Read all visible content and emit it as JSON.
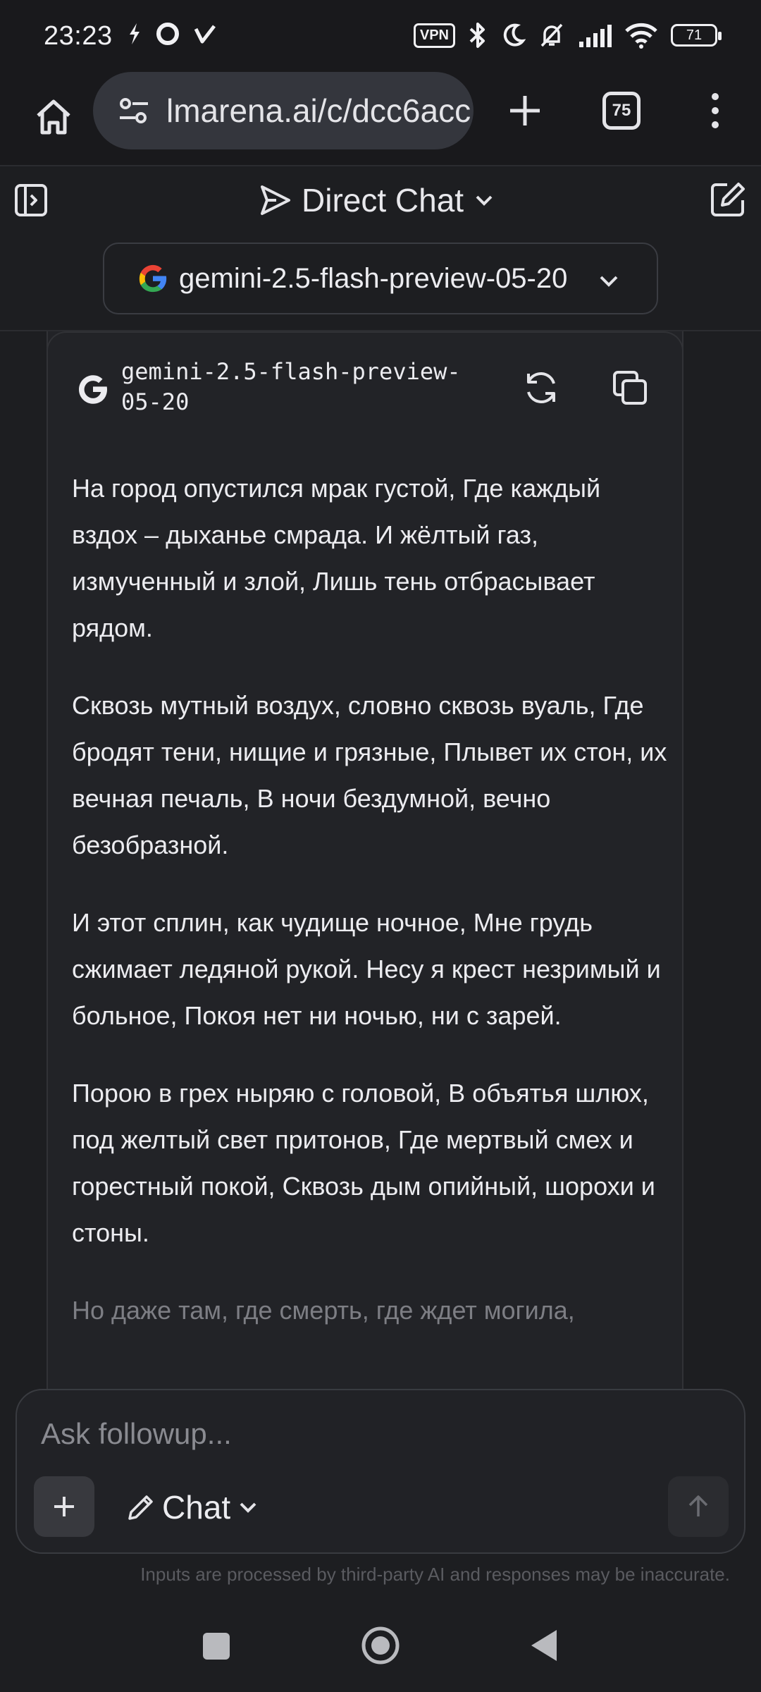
{
  "status_bar": {
    "time": "23:23",
    "vpn_label": "VPN",
    "battery": "71"
  },
  "browser": {
    "url": "lmarena.ai/c/dcc6acc",
    "tab_count": "75"
  },
  "header": {
    "title": "Direct Chat",
    "model_selector": "gemini-2.5-flash-preview-05-20"
  },
  "message": {
    "model_name": "gemini-2.5-flash-preview-05-20",
    "stanzas": [
      "На город опустился мрак густой, Где каждый вздох – дыханье смрада. И жёлтый газ, измученный и злой, Лишь тень отбрасывает рядом.",
      "Сквозь мутный воздух, словно сквозь вуаль, Где бродят тени, нищие и грязные, Плывет их стон, их вечная печаль, В ночи бездумной, вечно безобразной.",
      "И этот сплин, как чудище ночное, Мне грудь сжимает ледяной рукой. Несу я крест незримый и больное, Покоя нет ни ночью, ни с зарей.",
      "Порою в грех ныряю с головой, В объятья шлюх, под желтый свет притонов, Где мертвый смех и горестный покой, Сквозь дым опийный, шорохи и стоны.",
      "Но даже там, где смерть, где ждет могила,"
    ]
  },
  "composer": {
    "placeholder": "Ask followup...",
    "mode_label": "Chat",
    "disclaimer": "Inputs are processed by third-party AI and responses may be inaccurate."
  },
  "colors": {
    "background": "#1d1e21",
    "card": "#222327",
    "text": "#ececf0",
    "muted": "#8a8b91"
  }
}
